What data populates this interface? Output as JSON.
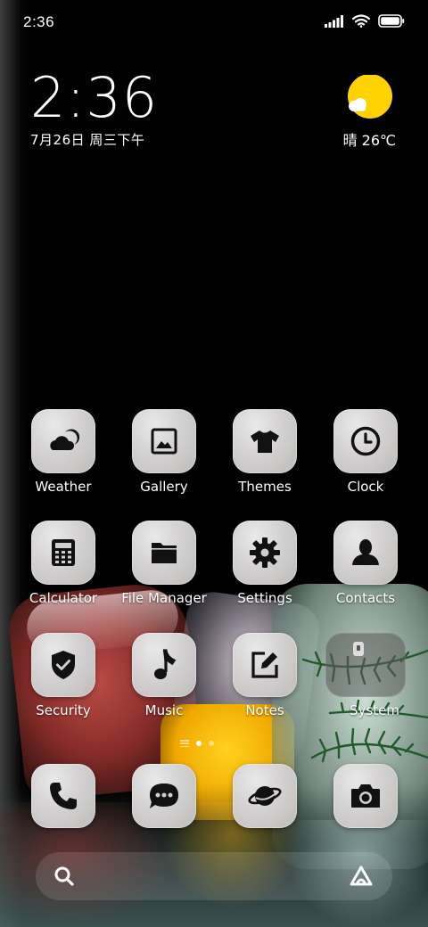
{
  "status_bar": {
    "time": "2:36"
  },
  "clock_widget": {
    "time": "2:36",
    "date": "7月26日 周三下午"
  },
  "weather_widget": {
    "text": "晴 26℃",
    "icon": "sunny-partly-cloudy-icon",
    "sun_color": "#FFD200"
  },
  "apps_row1": [
    {
      "label": "Weather",
      "icon": "weather-icon"
    },
    {
      "label": "Gallery",
      "icon": "gallery-icon"
    },
    {
      "label": "Themes",
      "icon": "tshirt-icon"
    },
    {
      "label": "Clock",
      "icon": "clock-icon"
    }
  ],
  "apps_row2": [
    {
      "label": "Calculator",
      "icon": "calculator-icon"
    },
    {
      "label": "File Manager",
      "icon": "folder-icon"
    },
    {
      "label": "Settings",
      "icon": "gear-icon"
    },
    {
      "label": "Contacts",
      "icon": "person-icon"
    }
  ],
  "apps_row3": [
    {
      "label": "Security",
      "icon": "shield-check-icon"
    },
    {
      "label": "Music",
      "icon": "music-note-icon"
    },
    {
      "label": "Notes",
      "icon": "edit-note-icon"
    },
    {
      "label": "System",
      "icon": "folder-icon"
    }
  ],
  "dock": [
    {
      "icon": "phone-icon"
    },
    {
      "icon": "message-icon"
    },
    {
      "icon": "browser-planet-icon"
    },
    {
      "icon": "camera-icon"
    }
  ],
  "page_indicator": {
    "pages": 2,
    "active": 1
  },
  "search_bar": {
    "left_icon": "search-icon",
    "right_icon": "assistant-icon"
  }
}
